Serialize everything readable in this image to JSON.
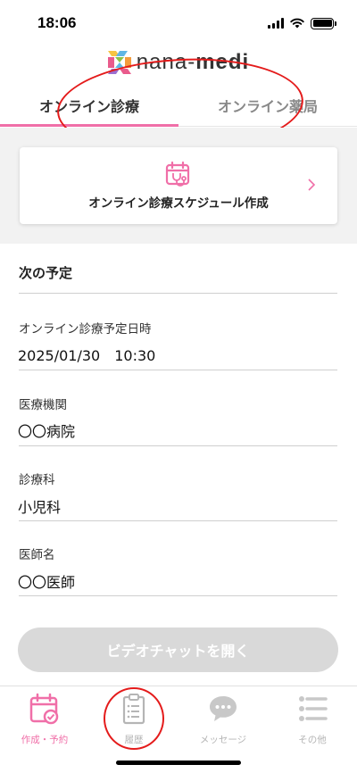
{
  "status_bar": {
    "time": "18:06"
  },
  "logo": {
    "text_light": "nana-",
    "text_bold": "medi"
  },
  "tabs": [
    {
      "label": "オンライン診療",
      "active": true
    },
    {
      "label": "オンライン薬局",
      "active": false
    }
  ],
  "schedule_card": {
    "label": "オンライン診療スケジュール作成",
    "icon": "calendar-stethoscope-icon"
  },
  "next_appointment": {
    "title": "次の予定",
    "fields": [
      {
        "label": "オンライン診療予定日時",
        "value": "2025/01/30　10:30"
      },
      {
        "label": "医療機関",
        "value": "〇〇病院"
      },
      {
        "label": "診療科",
        "value": "小児科"
      },
      {
        "label": "医師名",
        "value": "〇〇医師"
      }
    ]
  },
  "video_button": {
    "label": "ビデオチャットを開く",
    "enabled": false
  },
  "bottom_nav": [
    {
      "label": "作成・予約",
      "icon": "calendar-check-icon",
      "active": true
    },
    {
      "label": "履歴",
      "icon": "clipboard-icon",
      "active": false
    },
    {
      "label": "メッセージ",
      "icon": "chat-bubble-icon",
      "active": false
    },
    {
      "label": "その他",
      "icon": "list-icon",
      "active": false
    }
  ],
  "colors": {
    "accent": "#f06fa8",
    "annotation": "#e41b1b",
    "disabled": "#d9d9d9"
  }
}
